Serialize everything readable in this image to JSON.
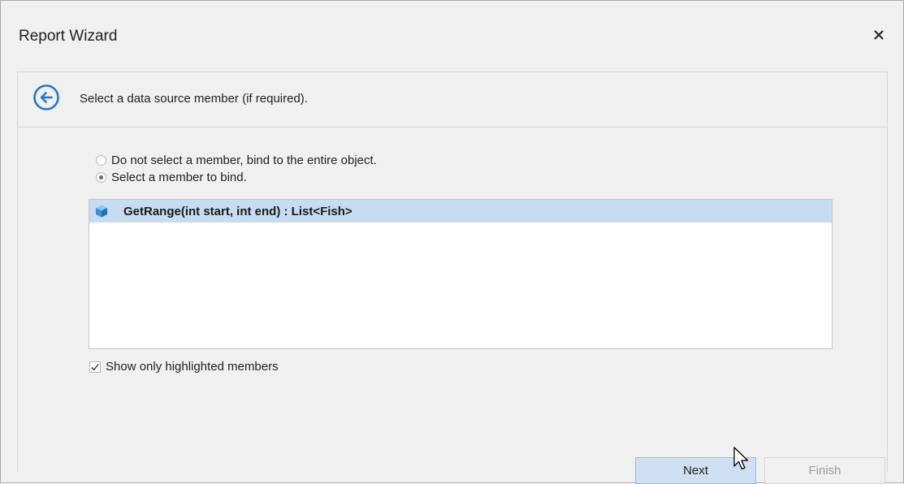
{
  "window": {
    "title": "Report Wizard",
    "close_icon": "close-icon"
  },
  "header": {
    "back_icon": "arrow-left-circle-icon",
    "instruction": "Select a data source member (if required)."
  },
  "options": {
    "radio_entire_object": {
      "label": "Do not select a member, bind to the entire object.",
      "checked": false
    },
    "radio_select_member": {
      "label": "Select a member to bind.",
      "checked": true
    }
  },
  "members": [
    {
      "icon": "cube-icon",
      "label": "GetRange(int start, int end) : List<Fish>",
      "selected": true
    }
  ],
  "show_highlighted": {
    "label": "Show only highlighted members",
    "checked": true
  },
  "footer": {
    "next_label": "Next",
    "finish_label": "Finish"
  },
  "colors": {
    "accent": "#1e78d7",
    "selection": "#c7dcf1",
    "next_button": "#cfe0f3"
  }
}
